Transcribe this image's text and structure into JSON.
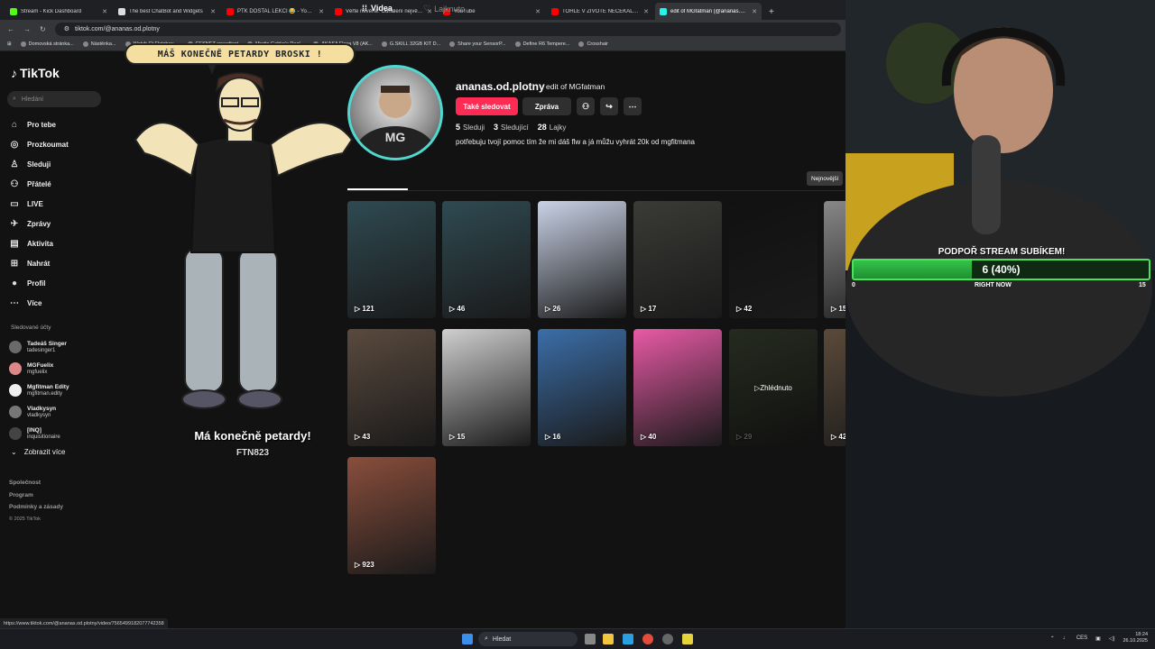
{
  "browser": {
    "tabs": [
      {
        "title": "Stream - Kick Dashboard",
        "color": "#53fc18",
        "active": false
      },
      {
        "title": "The best ChatBot and Widgets",
        "color": "#dddddd",
        "active": false
      },
      {
        "title": "PTK DOSTAL LEKCI 😂 - YouTube",
        "color": "#ff0000",
        "active": false
      },
      {
        "title": "Věřte nevěřte: Odhalení největší...",
        "color": "#ff0000",
        "active": false
      },
      {
        "title": "YouTube",
        "color": "#ff0000",
        "active": false
      },
      {
        "title": "TOHLE V ŽIVOTĚ NEČEKAL! - You...",
        "color": "#ff0000",
        "active": false
      },
      {
        "title": "edit of MGfatman (@ananas.od...",
        "color": "#25f4ee",
        "active": true
      }
    ],
    "url": "tiktok.com/@ananas.od.plotny",
    "bookmarks": [
      "Domovská stránka...",
      "Nástěnka...",
      "Watch Ct Fletcher:...",
      "CESNET speedtest",
      "Martin Gabko's Real...",
      "AKASA Flexa V8 (AK...",
      "G.SKILL 32GB KIT D...",
      "Share your SensorP...",
      "Define R6 Tempere...",
      "Crosshair"
    ],
    "status_url": "https://www.tiktok.com/@ananas.od.plotny/video/7565499182077742358"
  },
  "tiktok": {
    "logo": "TikTok",
    "search_placeholder": "Hledání",
    "nav": [
      {
        "label": "Pro tebe",
        "icon": "⌂"
      },
      {
        "label": "Prozkoumat",
        "icon": "◎"
      },
      {
        "label": "Sleduji",
        "icon": "♙"
      },
      {
        "label": "Přátelé",
        "icon": "⚇"
      },
      {
        "label": "LIVE",
        "icon": "▭"
      },
      {
        "label": "Zprávy",
        "icon": "✈"
      },
      {
        "label": "Aktivita",
        "icon": "▤"
      },
      {
        "label": "Nahrát",
        "icon": "⊞"
      },
      {
        "label": "Profil",
        "icon": "●"
      },
      {
        "label": "Více",
        "icon": "⋯"
      }
    ],
    "following_title": "Sledované účty",
    "following": [
      {
        "name": "Tadeáš Singer",
        "handle": "tadesinger1"
      },
      {
        "name": "MGFuelix",
        "handle": "mgfuelix"
      },
      {
        "name": "Mgfitman Edity",
        "handle": "mgfitman.edity"
      },
      {
        "name": "Vladkysyn",
        "handle": "vladkysyn"
      },
      {
        "name": "[INQ]",
        "handle": "inquisitionaire"
      }
    ],
    "show_more": "Zobrazit více",
    "footer": [
      "Společnost",
      "Program",
      "Podmínky a zásady"
    ],
    "copyright": "© 2025 TikTok"
  },
  "profile": {
    "username": "ananas.od.plotny",
    "display_name": "edit of MGfatman",
    "follow_label": "Také sledovat",
    "message_label": "Zpráva",
    "stats": [
      {
        "value": "5",
        "label": "Sleduji"
      },
      {
        "value": "3",
        "label": "Sledující"
      },
      {
        "value": "28",
        "label": "Lajky"
      }
    ],
    "bio": "potřebuju tvojí pomoc tím že mi dáš flw a já můžu vyhrát 20k od mgfitmana",
    "tab_videos": "Videa",
    "tab_liked": "Lajknuto",
    "sort_label": "Nejnovější",
    "videos": [
      {
        "views": "121",
        "color": "#2f4a52"
      },
      {
        "views": "46",
        "color": "#2f4a52"
      },
      {
        "views": "26",
        "color": "#c9d2e6"
      },
      {
        "views": "17",
        "color": "#3a3a36"
      },
      {
        "views": "42",
        "color": "#111111"
      },
      {
        "views": "15",
        "color": "#888888"
      },
      {
        "views": "43",
        "color": "#5a4a3e"
      },
      {
        "views": "15",
        "color": "#cfcfcf"
      },
      {
        "views": "16",
        "color": "#3b6ea8"
      },
      {
        "views": "40",
        "color": "#e85aa6"
      },
      {
        "views": "29",
        "color": "#3a4230",
        "watched": "Zhlédnuto"
      },
      {
        "views": "42",
        "color": "#5b4a3a"
      },
      {
        "views": "923",
        "color": "#8a4e3c"
      }
    ]
  },
  "overlay": {
    "speech": "MÁŠ KONEČNĚ PETARDY BROSKI !",
    "caption": "Má konečně petardy!",
    "caption2": "FTN823"
  },
  "stream": {
    "goal_title": "PODPOŘ STREAM SUBÍKEM!",
    "goal_value": "6 (40%)",
    "goal_fraction": 0.4,
    "goal_min": "0",
    "goal_max": "15",
    "goal_status": "RIGHT NOW"
  },
  "taskbar": {
    "search": "Hledat",
    "lang": "CES",
    "time": "18:24",
    "date": "26.10.2025"
  }
}
